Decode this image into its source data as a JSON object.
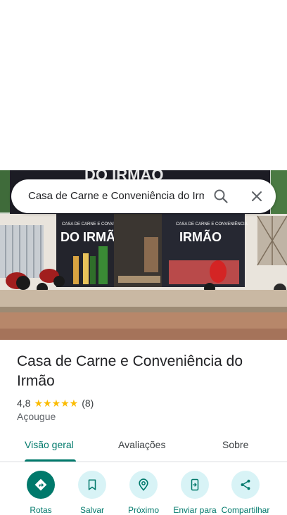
{
  "search": {
    "query": "Casa de Carne e Conveniência do Irmão"
  },
  "photo": {
    "sign_top": "DO IRMÃO",
    "sign_left_small": "CASA DE CARNE E CONVENIÊNCIA",
    "sign_left_big": "DO IRMÃO",
    "sign_right_small": "CASA DE CARNE E CONVENIÊNCIA",
    "sign_right_big": "IRMÃO"
  },
  "place": {
    "title": "Casa de Carne e Conveniência do Irmão",
    "rating": "4,8",
    "stars": "★★★★★",
    "review_count": "(8)",
    "category": "Açougue"
  },
  "tabs": [
    {
      "label": "Visão geral",
      "active": true
    },
    {
      "label": "Avaliações",
      "active": false
    },
    {
      "label": "Sobre",
      "active": false
    }
  ],
  "actions": [
    {
      "label": "Rotas",
      "icon": "directions-icon"
    },
    {
      "label": "Salvar",
      "icon": "bookmark-icon"
    },
    {
      "label": "Próximo",
      "icon": "nearby-icon"
    },
    {
      "label": "Enviar para",
      "icon": "send-to-phone-icon"
    },
    {
      "label": "Compartilhar",
      "icon": "share-icon"
    }
  ],
  "colors": {
    "accent": "#00796b",
    "action_bg": "#d8f3f6",
    "star": "#fbbc04"
  }
}
